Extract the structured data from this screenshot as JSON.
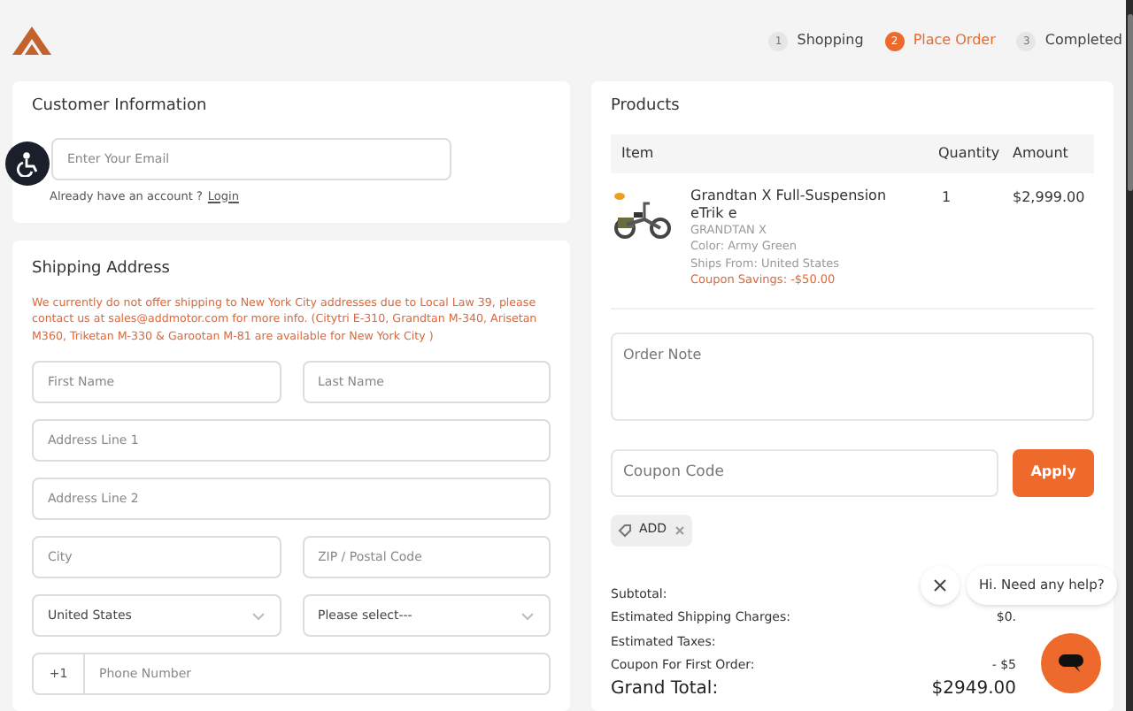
{
  "steps": [
    {
      "number": "1",
      "label": "Shopping",
      "selected": false
    },
    {
      "number": "2",
      "label": "Place Order",
      "selected": true
    },
    {
      "number": "3",
      "label": "Completed",
      "selected": false
    }
  ],
  "customer": {
    "title": "Customer Information",
    "email_placeholder": "Enter Your Email",
    "account_text": "Already have an account ?",
    "login_link": "Login"
  },
  "shipping": {
    "title": "Shipping Address",
    "notice": "We currently do not offer shipping to New York City addresses due to Local Law 39, please contact us at sales@addmotor.com for more info. (Citytri E-310, Grandtan M-340, Arisetan M360, Triketan M-330 & Garootan M-81 are available for New York City )",
    "fields": [
      {
        "kind": "pair",
        "items": [
          {
            "placeholder": "First Name"
          },
          {
            "placeholder": "Last Name"
          }
        ]
      },
      {
        "kind": "single",
        "items": [
          {
            "placeholder": "Address Line 1"
          }
        ]
      },
      {
        "kind": "single",
        "items": [
          {
            "placeholder": "Address Line 2"
          }
        ]
      },
      {
        "kind": "pair",
        "items": [
          {
            "placeholder": "City"
          },
          {
            "placeholder": "ZIP / Postal Code"
          }
        ]
      },
      {
        "kind": "selects",
        "items": [
          {
            "value": "United States"
          },
          {
            "value": "Please select---"
          }
        ]
      },
      {
        "kind": "phone",
        "prefix": "+1",
        "items": [
          {
            "placeholder": "Phone Number"
          }
        ]
      }
    ]
  },
  "products": {
    "title": "Products",
    "columns": [
      "Item",
      "Quantity",
      "Amount"
    ],
    "items": [
      {
        "name": "Grandtan X Full-Suspension eTrik e",
        "model": "GRANDTAN X",
        "color_text": "Color:  Army Green",
        "ships_from": "Ships From:  United States",
        "savings": "Coupon Savings:  -$50.00",
        "quantity": "1",
        "amount": "$2,999.00"
      }
    ],
    "order_note_placeholder": "Order Note",
    "coupon_placeholder": "Coupon Code",
    "apply": "Apply",
    "tag": "ADD",
    "summary": [
      {
        "label": "Subtotal:"
      },
      {
        "label": "Estimated Shipping Charges:",
        "value": "$0."
      },
      {
        "label": "Estimated Taxes:"
      },
      {
        "label": "Coupon For First Order:",
        "value": "- $5"
      }
    ],
    "grand_total": {
      "label": "Grand Total:",
      "value": "$2949.00"
    }
  },
  "chat": {
    "message": "Hi. Need any help?"
  }
}
